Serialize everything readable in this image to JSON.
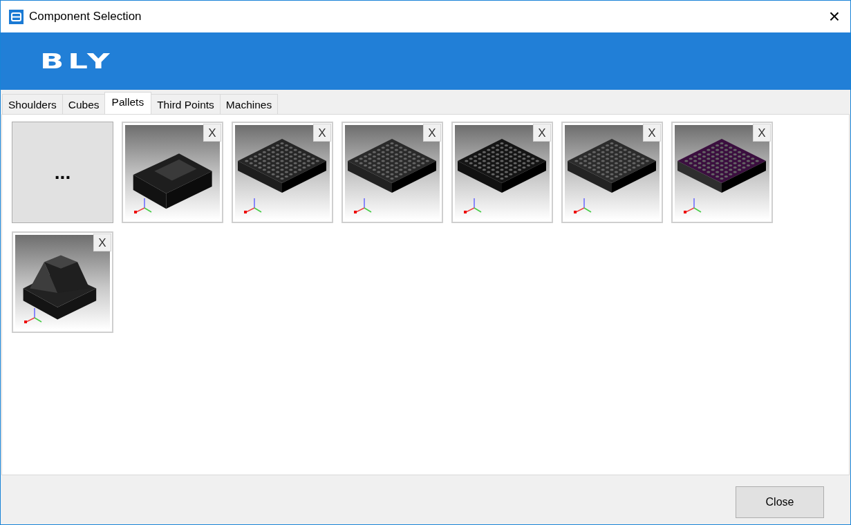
{
  "window": {
    "title": "Component Selection",
    "close_glyph": "×"
  },
  "banner": {
    "logo": "BLY"
  },
  "tabs": [
    {
      "label": "Shoulders",
      "selected": false
    },
    {
      "label": "Cubes",
      "selected": false
    },
    {
      "label": "Pallets",
      "selected": true
    },
    {
      "label": "Third Points",
      "selected": false
    },
    {
      "label": "Machines",
      "selected": false
    }
  ],
  "components": [
    {
      "kind": "add",
      "label": "..."
    },
    {
      "kind": "raised",
      "color": "#1e1e1e",
      "remove_label": "X"
    },
    {
      "kind": "slab",
      "color": "#262626",
      "remove_label": "X"
    },
    {
      "kind": "slab",
      "color": "#2a2a2a",
      "remove_label": "X"
    },
    {
      "kind": "slab",
      "color": "#151515",
      "remove_label": "X"
    },
    {
      "kind": "slab",
      "color": "#2c2c2c",
      "remove_label": "X"
    },
    {
      "kind": "slab",
      "color": "#3b0f3f",
      "remove_label": "X"
    },
    {
      "kind": "pyramid",
      "color": "#222222",
      "remove_label": "X"
    }
  ],
  "footer": {
    "close_button": "Close"
  }
}
